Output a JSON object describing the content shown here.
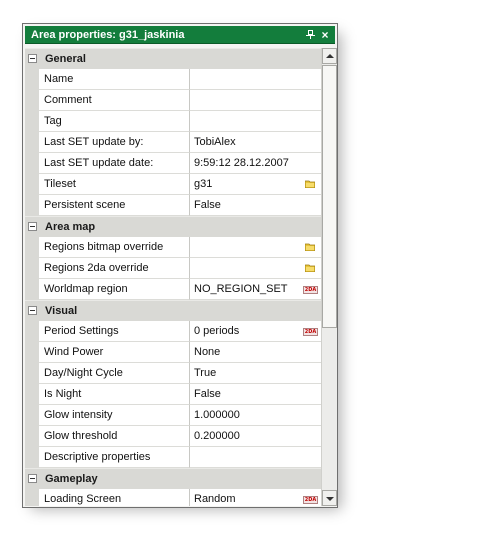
{
  "window": {
    "title": "Area properties: g31_jaskinia",
    "accent_color": "#137d3c"
  },
  "categories": {
    "general": "General",
    "area_map": "Area map",
    "visual": "Visual",
    "gameplay": "Gameplay"
  },
  "props": {
    "name": {
      "label": "Name",
      "value": ""
    },
    "comment": {
      "label": "Comment",
      "value": ""
    },
    "tag": {
      "label": "Tag",
      "value": ""
    },
    "last_set_by": {
      "label": "Last SET update by:",
      "value": "TobiAlex"
    },
    "last_set_date": {
      "label": "Last SET update date:",
      "value": "9:59:12 28.12.2007"
    },
    "tileset": {
      "label": "Tileset",
      "value": "g31"
    },
    "persistent_scene": {
      "label": "Persistent scene",
      "value": "False"
    },
    "regions_bitmap": {
      "label": "Regions bitmap override",
      "value": ""
    },
    "regions_2da": {
      "label": "Regions 2da override",
      "value": ""
    },
    "worldmap_region": {
      "label": "Worldmap region",
      "value": "NO_REGION_SET"
    },
    "period_settings": {
      "label": "Period Settings",
      "value": "0 periods"
    },
    "wind_power": {
      "label": "Wind Power",
      "value": "None"
    },
    "day_night": {
      "label": "Day/Night Cycle",
      "value": "True"
    },
    "is_night": {
      "label": "Is Night",
      "value": "False"
    },
    "glow_intensity": {
      "label": "Glow intensity",
      "value": "1.000000"
    },
    "glow_threshold": {
      "label": "Glow threshold",
      "value": "0.200000"
    },
    "descriptive": {
      "label": "Descriptive properties",
      "value": ""
    },
    "loading_screen": {
      "label": "Loading Screen",
      "value": "Random"
    }
  },
  "icons": {
    "folder": "folder-icon",
    "twoda": "2da-icon",
    "twoda_text": "2DA",
    "pin": "pin-icon",
    "close": "close-icon",
    "close_glyph": "×"
  }
}
